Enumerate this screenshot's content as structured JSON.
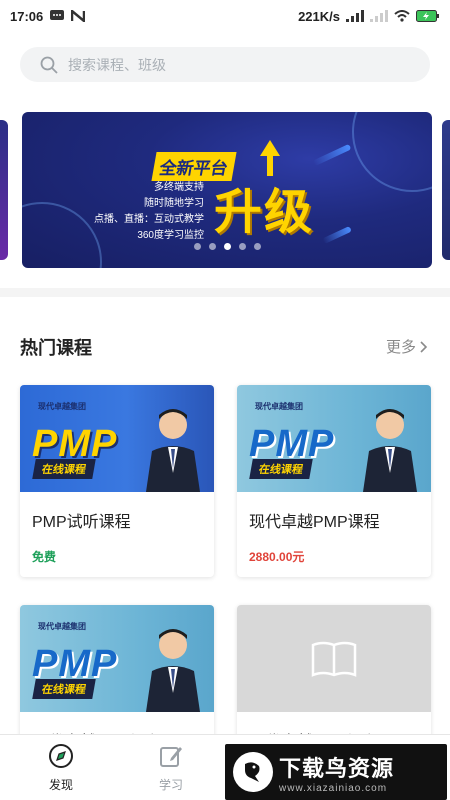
{
  "status": {
    "time": "17:06",
    "network_speed": "221K/s",
    "icons": [
      "message-icon",
      "n-app-icon",
      "signal-icon",
      "wifi-icon",
      "battery-charging-icon"
    ]
  },
  "search": {
    "placeholder": "搜索课程、班级",
    "icon": "search-icon"
  },
  "banner": {
    "tag": "全新平台",
    "headline": "升级",
    "features": [
      "多终端支持",
      "随时随地学习",
      "点播、直播：互动式教学",
      "360度学习监控"
    ],
    "dots_total": 5,
    "active_dot": 2
  },
  "hot": {
    "title": "热门课程",
    "more": "更多",
    "courses": [
      {
        "title": "PMP试听课程",
        "price": "免费",
        "thumb_word": "PMP",
        "thumb_tag": "在线课程",
        "thumb_brand": "现代卓越集团"
      },
      {
        "title": "现代卓越PMP课程",
        "price": "2880.00元",
        "thumb_word": "PMP",
        "thumb_tag": "在线课程",
        "thumb_brand": "现代卓越集团"
      },
      {
        "title": "现代卓越PMP课程一",
        "thumb_word": "PMP",
        "thumb_tag": "在线课程",
        "thumb_brand": "现代卓越集团"
      },
      {
        "title": "现代卓越PMP课程一"
      }
    ]
  },
  "tabs": [
    {
      "label": "发现",
      "icon": "compass-icon",
      "active": true
    },
    {
      "label": "学习",
      "icon": "edit-icon",
      "active": false
    }
  ],
  "watermark": {
    "big": "下载鸟资源",
    "small": "www.xiazainiao.com"
  },
  "colors": {
    "accent_green": "#1ea05a",
    "price_red": "#e0443a",
    "banner_yellow": "#ffd400"
  }
}
